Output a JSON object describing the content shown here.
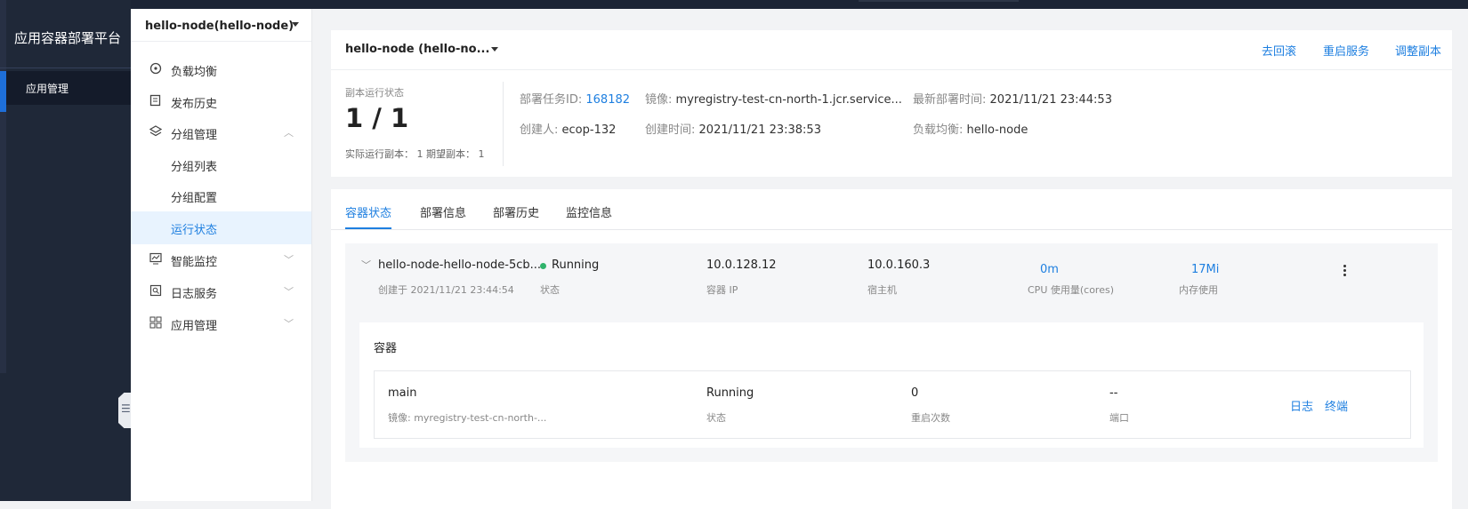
{
  "sidebar": {
    "app_title": "应用容器部署平台",
    "nav_item": "应用管理"
  },
  "submenu": {
    "app_selector": "hello-node(hello-node)",
    "items": [
      {
        "label": "负载均衡",
        "icon": "load-balancer-icon"
      },
      {
        "label": "发布历史",
        "icon": "history-icon"
      },
      {
        "label": "分组管理",
        "icon": "layers-icon"
      },
      {
        "label": "分组列表"
      },
      {
        "label": "分组配置"
      },
      {
        "label": "运行状态"
      },
      {
        "label": "智能监控",
        "icon": "monitor-icon"
      },
      {
        "label": "日志服务",
        "icon": "log-icon"
      },
      {
        "label": "应用管理",
        "icon": "apps-icon"
      }
    ]
  },
  "header": {
    "app_title": "hello-node (hello-no...",
    "actions": [
      "去回滚",
      "重启服务",
      "调整副本"
    ],
    "replica_label": "副本运行状态",
    "replica_count": "1 / 1",
    "replica_meta": "实际运行副本：  1   期望副本：  1",
    "fields": {
      "task_id_label": "部署任务ID:",
      "task_id": "168182",
      "image_label": "镜像:",
      "image": "myregistry-test-cn-north-1.jcr.service...",
      "latest_time_label": "最新部署时间:",
      "latest_time": "2021/11/21 23:44:53",
      "creator_label": "创建人:",
      "creator": "ecop-132",
      "created_label": "创建时间:",
      "created": "2021/11/21 23:38:53",
      "lb_label": "负载均衡:",
      "lb": "hello-node"
    }
  },
  "tabs": [
    "容器状态",
    "部署信息",
    "部署历史",
    "监控信息"
  ],
  "pod": {
    "name": "hello-node-hello-node-5cb...",
    "created": "创建于 2021/11/21 23:44:54",
    "status": "Running",
    "status_label": "状态",
    "ip": "10.0.128.12",
    "ip_label": "容器 IP",
    "host": "10.0.160.3",
    "host_label": "宿主机",
    "cpu": "0m",
    "cpu_label": "CPU 使用量(cores)",
    "mem": "17Mi",
    "mem_label": "内存使用",
    "status_color": "#2fb36b"
  },
  "containers": {
    "title": "容器",
    "rows": [
      {
        "name": "main",
        "image": "镜像:  myregistry-test-cn-north-...",
        "status": "Running",
        "status_label": "状态",
        "restarts": "0",
        "restarts_label": "重启次数",
        "port": "--",
        "port_label": "端口",
        "actions": [
          "日志",
          "终端"
        ]
      }
    ]
  },
  "colors": {
    "accent": "#1e7fe0",
    "sidebar_bg": "#1f2838"
  }
}
